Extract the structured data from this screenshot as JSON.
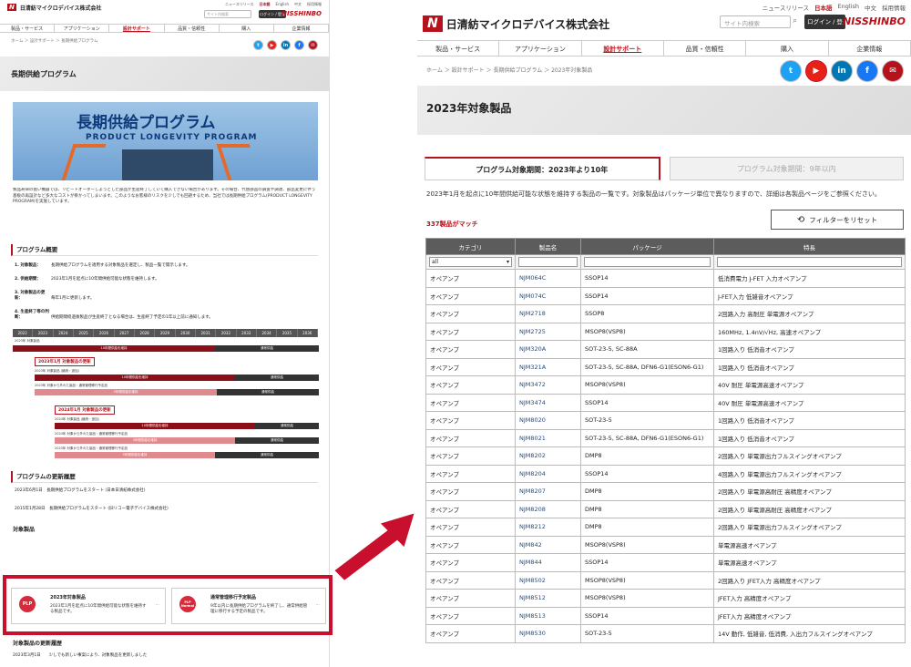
{
  "brand": {
    "logo_mark": "N",
    "company": "日清紡マイクロデバイス株式会社",
    "group": "NISSHINBO"
  },
  "toplinks": [
    "ニュースリリース",
    "日本語",
    "English",
    "中文",
    "採用情報"
  ],
  "search": {
    "placeholder": "サイト内検索"
  },
  "login": "ログイン / 登録",
  "nav": [
    "製品・サービス",
    "アプリケーション",
    "設計サポート",
    "品質・信頼性",
    "購入",
    "企業情報"
  ],
  "nav_active": 2,
  "social": [
    "t",
    "▶",
    "in",
    "f",
    "✉"
  ],
  "left": {
    "breadcrumb": "ホーム ＞ 設計サポート ＞ 長期供給プログラム",
    "title": "長期供給プログラム",
    "hero_title": "長期供給プログラム",
    "hero_sub": "PRODUCT LONGEVITY PROGRAM",
    "intro": "製品寿命の長い機器では、リピートオーダーしようとした部品が生産終了していて購入できない場合があります。その場合、代替部品の調査や調達、部品変更に伴う基板の再設計など多大なコストが掛かってしまいます。このようなお客様のリスクを少しでも回避するため、当社では長期供給プログラム(PRODUCT LONGEVITY PROGRAM)を実施しています。",
    "overview_title": "プログラム概要",
    "overview": [
      {
        "k": "1. 対象製品：",
        "v": "長期供給プログラムを適用する対象製品を選定し、製品一覧で開示します。"
      },
      {
        "k": "2. 供給期間：",
        "v": "2023年1月を起点に10年間供給可能な状態を維持します。"
      },
      {
        "k": "3. 対象製品の更新：",
        "v": "毎年1月に更新します。"
      },
      {
        "k": "4. 生産終了等の判断：",
        "v": "供給期間経過後製品が生産終了となる場合は、生産終了予定の1年以上前に通知します。"
      }
    ],
    "years": [
      "2022",
      "2023",
      "2024",
      "2025",
      "2026",
      "2027",
      "2028",
      "2029",
      "2030",
      "2031",
      "2032",
      "2033",
      "2034",
      "2035",
      "2036"
    ],
    "gantt": {
      "l1": "2023年 対象製品",
      "b1": "10年間供給を維持",
      "n1": "通常供給",
      "box1": "2023年1月 対象製品の更新",
      "l2": "2023年 対象製品 (継続・追加)",
      "l3": "2023年 対象から外れた製品・通常管理移行予定品",
      "box2": "2024年1月 対象製品の更新",
      "l4": "2024年 対象製品 (継続・追加)",
      "l5": "2024年 対象から外れた製品・通常管理移行予定品",
      "l6": "2023年 対象から外れた製品・通常管理移行予定品",
      "b2": "5年間供給を維持"
    },
    "history_title": "プログラムの更新履歴",
    "history": [
      {
        "date": "2023年6月1日",
        "text": "長期供給プログラムをスタート (日本日清紡株式会社)"
      },
      {
        "date": "2015年1月28日",
        "text": "長期供給プログラムをスタート (旧リコー電子デバイス株式会社)"
      }
    ],
    "products_title": "対象製品",
    "cards": [
      {
        "badge": "PLP",
        "title": "2023年対象製品",
        "desc": "2023年1月を起点に10年間供給可能な状態を維持する製品です。",
        "more": "…"
      },
      {
        "badge": "PLP Normal",
        "title": "通常管理移行予定製品",
        "desc": "9年以内に長期供給プログラムを終了し、通常供給管理に移行する予定の製品です。",
        "more": "…"
      }
    ],
    "update_title": "対象製品の更新履歴",
    "update_line": "2023年3月1日　　少しでも新しい事案により、対象製品を更新しました"
  },
  "right": {
    "breadcrumb": "ホーム ＞ 設計サポート ＞ 長期供給プログラム ＞ 2023年対象製品",
    "title": "2023年対象製品",
    "tab_active": "プログラム対象期間：2023年より10年",
    "tab_other": "プログラム対象期間：9年以内",
    "desc": "2023年1月を起点に10年間供給可能な状態を維持する製品の一覧です。対象製品はパッケージ単位で異なりますので、詳細は各製品ページをご参照ください。",
    "match": "337製品がマッチ",
    "reset": "フィルターをリセット",
    "columns": [
      "カテゴリ",
      "製品名",
      "パッケージ",
      "特長"
    ],
    "filter_category": "all",
    "rows": [
      [
        "オペアンプ",
        "NJM064C",
        "SSOP14",
        "低消費電力 J-FET 入力オペアンプ"
      ],
      [
        "オペアンプ",
        "NJM074C",
        "SSOP14",
        "J-FET入力 低雑音オペアンプ"
      ],
      [
        "オペアンプ",
        "NJM2718",
        "SSOP8",
        "2回路入力 高耐圧 単電源オペアンプ"
      ],
      [
        "オペアンプ",
        "NJM2725",
        "MSOP8(VSP8)",
        "160MHz, 1.4nV/√Hz, 高速オペアンプ"
      ],
      [
        "オペアンプ",
        "NJM320A",
        "SOT-23-5, SC-88A",
        "1回路入り 低消音オペアンプ"
      ],
      [
        "オペアンプ",
        "NJM321A",
        "SOT-23-5, SC-88A, DFN6-G1(ESON6-G1)",
        "1回路入り 低消音オペアンプ"
      ],
      [
        "オペアンプ",
        "NJM3472",
        "MSOP8(VSP8)",
        "40V 耐圧 単電源高速オペアンプ"
      ],
      [
        "オペアンプ",
        "NJM3474",
        "SSOP14",
        "40V 耐圧 単電源高速オペアンプ"
      ],
      [
        "オペアンプ",
        "NJM8020",
        "SOT-23-5",
        "1回路入り 低消音オペアンプ"
      ],
      [
        "オペアンプ",
        "NJM8021",
        "SOT-23-5, SC-88A, DFN6-G1(ESON6-G1)",
        "1回路入り 低消音オペアンプ"
      ],
      [
        "オペアンプ",
        "NJM8202",
        "DMP8",
        "2回路入り 単電源出力フルスイングオペアンプ"
      ],
      [
        "オペアンプ",
        "NJM8204",
        "SSOP14",
        "4回路入り 単電源出力フルスイングオペアンプ"
      ],
      [
        "オペアンプ",
        "NJM8207",
        "DMP8",
        "2回路入り 単電源高耐圧 高精度オペアンプ"
      ],
      [
        "オペアンプ",
        "NJM8208",
        "DMP8",
        "2回路入り 単電源高耐圧 高精度オペアンプ"
      ],
      [
        "オペアンプ",
        "NJM8212",
        "DMP8",
        "2回路入り 単電源出力フルスイングオペアンプ"
      ],
      [
        "オペアンプ",
        "NJM842",
        "MSOP8(VSP8)",
        "単電源高速オペアンプ"
      ],
      [
        "オペアンプ",
        "NJM844",
        "SSOP14",
        "単電源高速オペアンプ"
      ],
      [
        "オペアンプ",
        "NJM8502",
        "MSOP8(VSP8)",
        "2回路入り JFET入力 高精度オペアンプ"
      ],
      [
        "オペアンプ",
        "NJM8512",
        "MSOP8(VSP8)",
        "JFET入力 高精度オペアンプ"
      ],
      [
        "オペアンプ",
        "NJM8513",
        "SSOP14",
        "JFET入力 高精度オペアンプ"
      ],
      [
        "オペアンプ",
        "NJM8530",
        "SOT-23-5",
        "14V 動作, 低雑音, 低消費, 入出力フルスイングオペアンプ"
      ]
    ]
  },
  "colors": {
    "brand_red": "#b5121b",
    "highlight": "#c8102e",
    "social": [
      "#1da1f2",
      "#e62117",
      "#0077b5",
      "#1877f2",
      "#b5121b"
    ]
  }
}
